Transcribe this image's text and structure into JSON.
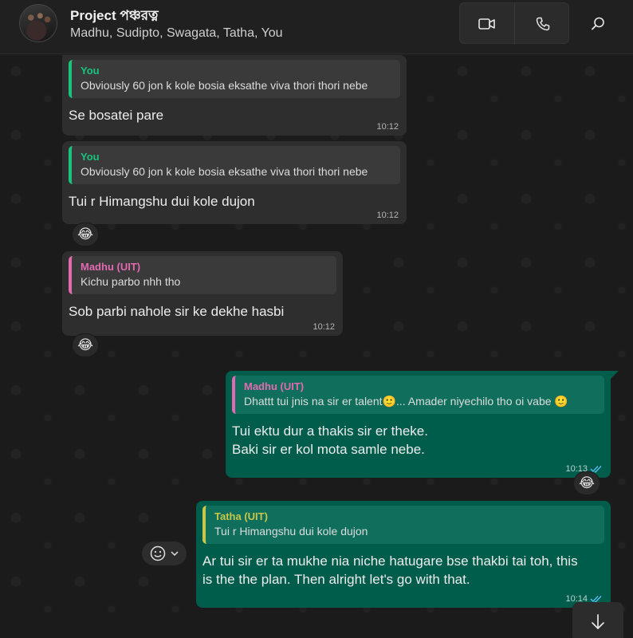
{
  "header": {
    "title": "Project পঞ্চরত্ন",
    "subtitle": "Madhu, Sudipto, Swagata, Tatha, You"
  },
  "messages": [
    {
      "quote_author": "You",
      "quote_author_color": "#19c37d",
      "quote_text": "Obviously 60 jon k kole bosia eksathe viva thori thori nebe",
      "text": "Se bosatei pare",
      "time": "10:12"
    },
    {
      "quote_author": "You",
      "quote_author_color": "#19c37d",
      "quote_text": "Obviously 60 jon k kole bosia eksathe viva thori thori nebe",
      "text": "Tui r Himangshu dui kole dujon",
      "time": "10:12",
      "reaction": "😂"
    },
    {
      "quote_author": "Madhu (UIT)",
      "quote_author_color": "#e26ab0",
      "quote_text": "Kichu parbo nhh tho",
      "text": "Sob parbi nahole sir ke dekhe hasbi",
      "time": "10:12",
      "reaction": "😂"
    },
    {
      "quote_author": "Madhu (UIT)",
      "quote_author_color": "#e26ab0",
      "quote_text": "Dhattt tui jnis na sir er talent🙂... Amader niyechilo tho oi vabe 🙂",
      "text_line1": "Tui ektu dur a thakis sir er theke.",
      "text_line2": "Baki sir er kol mota samle nebe.",
      "time": "10:13",
      "reaction": "😂"
    },
    {
      "quote_author": "Tatha (UIT)",
      "quote_author_color": "#c7c74a",
      "quote_text": "Tui r Himangshu dui kole dujon",
      "text_line1": "Ar tui sir er ta mukhe nia niche hatugare bse thakbi tai toh, this",
      "text_line2": "is the the plan. Then alright let's go with that.",
      "time": "10:14"
    }
  ],
  "colors": {
    "outgoing_bubble": "#005c4b",
    "incoming_bubble": "#2e2e2e",
    "read_ticks": "#53bdeb"
  },
  "icons": [
    "video-call-icon",
    "voice-call-icon",
    "search-icon",
    "smiley-icon",
    "chevron-down-icon",
    "arrow-down-icon",
    "double-check-icon"
  ]
}
